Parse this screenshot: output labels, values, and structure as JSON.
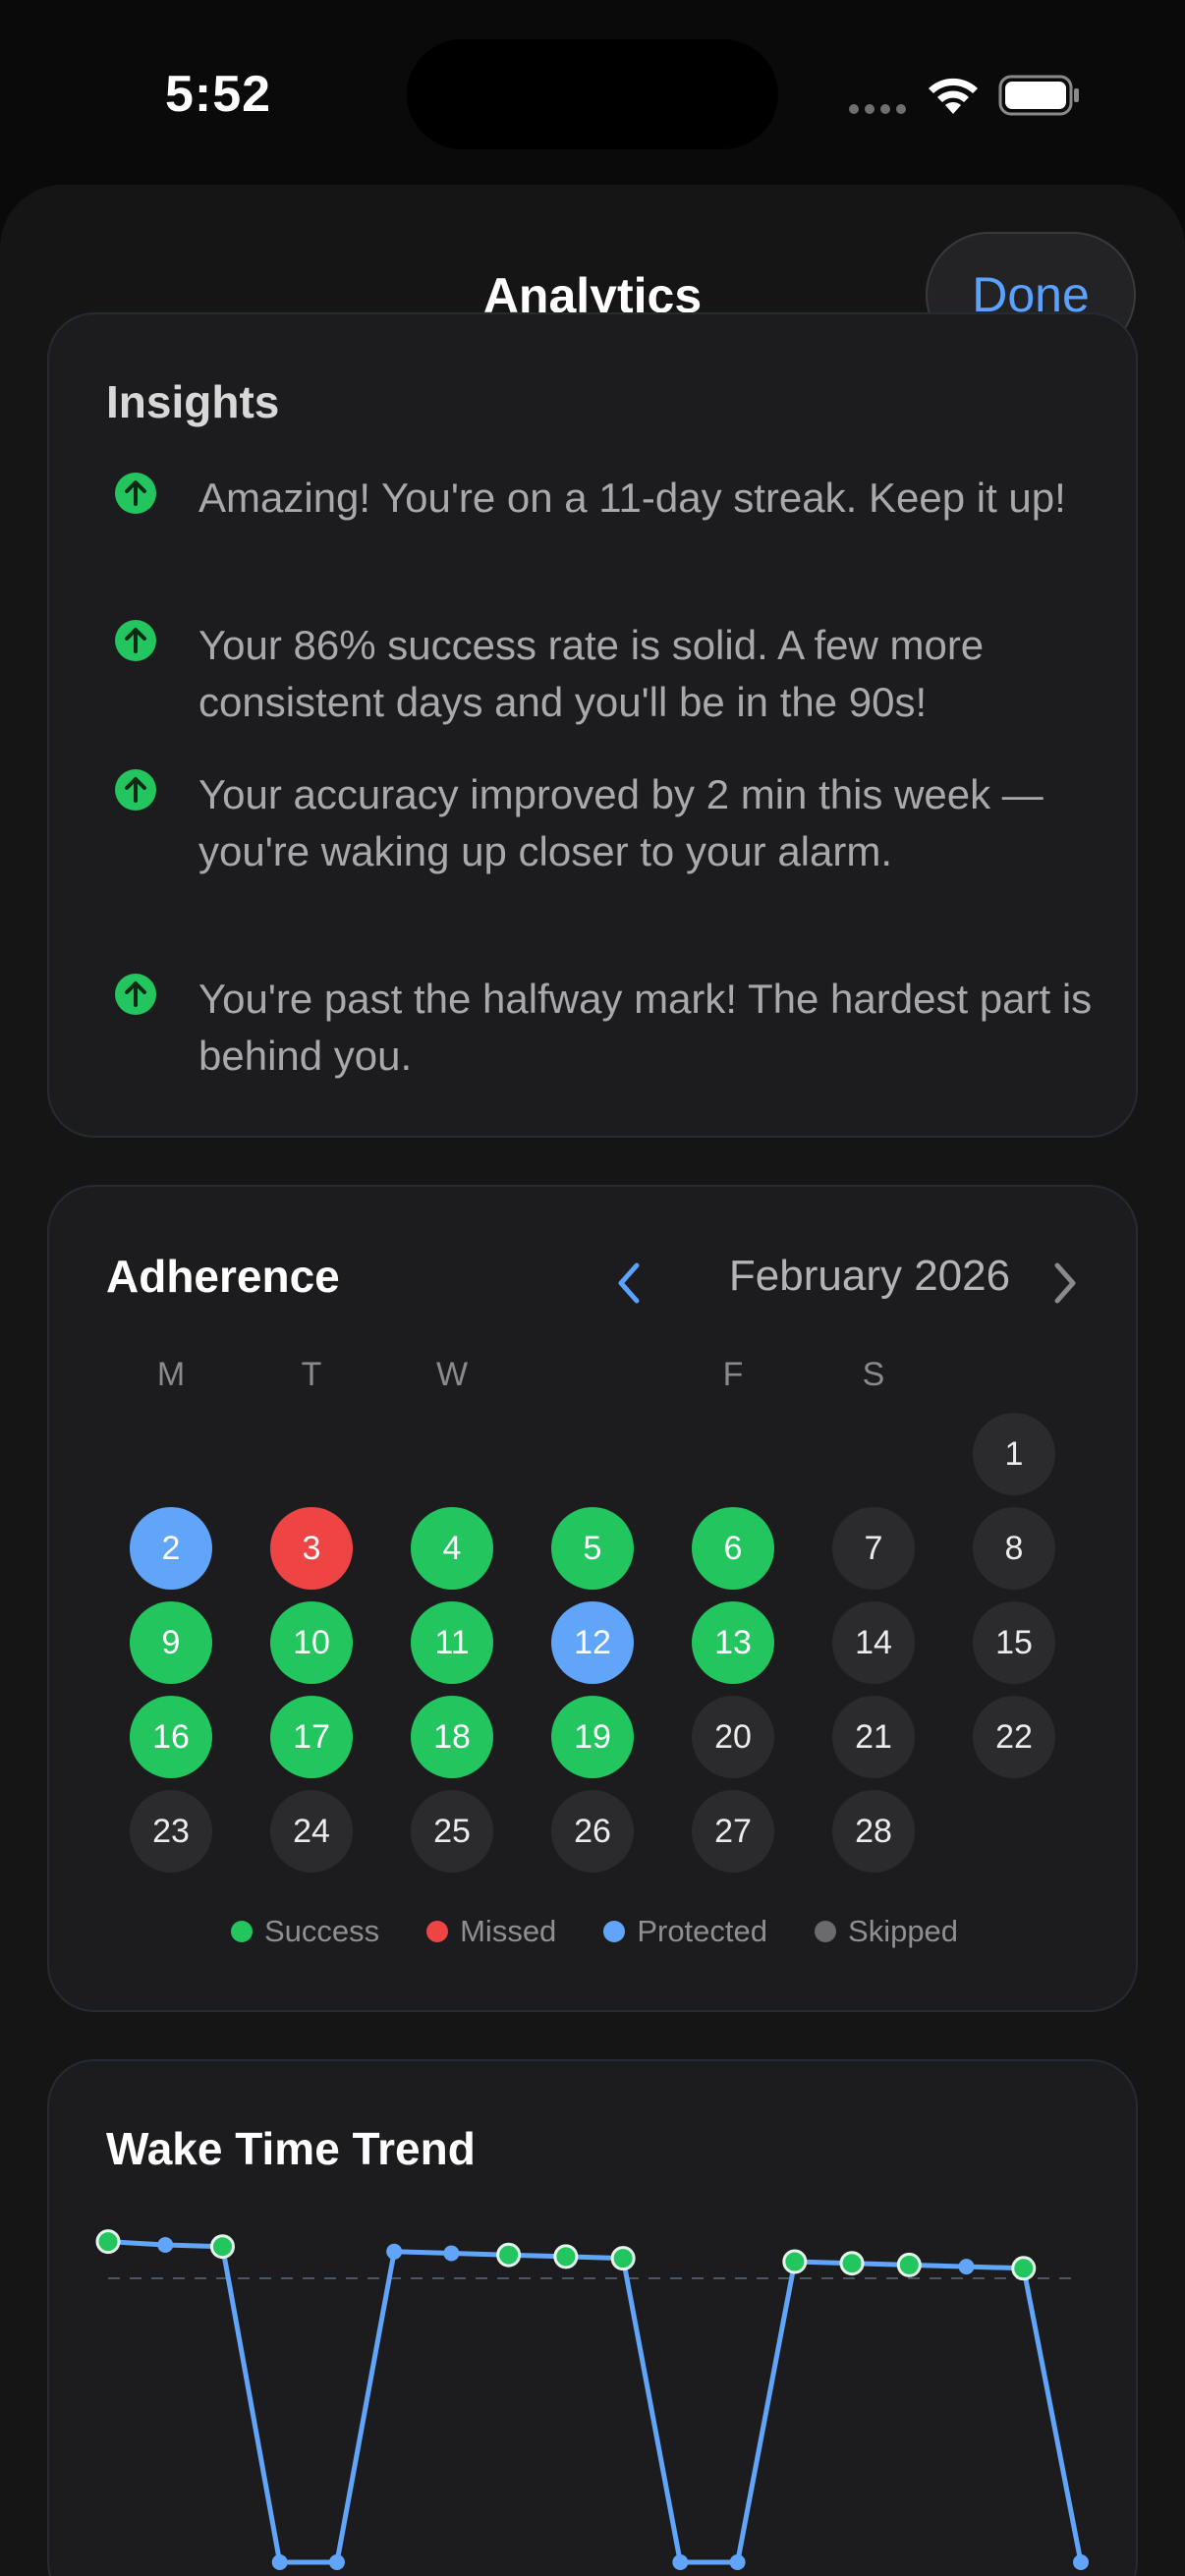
{
  "status": {
    "time": "5:52"
  },
  "header": {
    "title": "Analytics",
    "done_label": "Done"
  },
  "colors": {
    "success": "#22c55e",
    "missed": "#ef4444",
    "protected": "#60a5fa",
    "skipped": "#6b6b6e",
    "accent": "#5aa2ff"
  },
  "insights": {
    "title": "Insights",
    "items": [
      {
        "icon": "arrow-up-circle-icon",
        "text": "Amazing! You're on a 11-day streak. Keep it up!"
      },
      {
        "icon": "arrow-up-circle-icon",
        "text": "Your 86% success rate is solid. A few more consistent days and you'll be in the 90s!"
      },
      {
        "icon": "arrow-up-circle-icon",
        "text": "Your accuracy improved by 2 min this week — you're waking up closer to your alarm."
      },
      {
        "icon": "arrow-up-circle-icon",
        "text": "You're past the halfway mark! The hardest part is behind you."
      }
    ]
  },
  "adherence": {
    "title": "Adherence",
    "month": "February 2026",
    "weekdays": [
      "M",
      "T",
      "W",
      "",
      "F",
      "S",
      ""
    ],
    "days": [
      {
        "d": "1",
        "status": "none"
      },
      {
        "d": "2",
        "status": "protected"
      },
      {
        "d": "3",
        "status": "missed"
      },
      {
        "d": "4",
        "status": "success"
      },
      {
        "d": "5",
        "status": "success"
      },
      {
        "d": "6",
        "status": "success"
      },
      {
        "d": "7",
        "status": "none"
      },
      {
        "d": "8",
        "status": "none"
      },
      {
        "d": "9",
        "status": "success"
      },
      {
        "d": "10",
        "status": "success"
      },
      {
        "d": "11",
        "status": "success"
      },
      {
        "d": "12",
        "status": "protected"
      },
      {
        "d": "13",
        "status": "success"
      },
      {
        "d": "14",
        "status": "none"
      },
      {
        "d": "15",
        "status": "none"
      },
      {
        "d": "16",
        "status": "success"
      },
      {
        "d": "17",
        "status": "success"
      },
      {
        "d": "18",
        "status": "success"
      },
      {
        "d": "19",
        "status": "success"
      },
      {
        "d": "20",
        "status": "none"
      },
      {
        "d": "21",
        "status": "none"
      },
      {
        "d": "22",
        "status": "none"
      },
      {
        "d": "23",
        "status": "none"
      },
      {
        "d": "24",
        "status": "none"
      },
      {
        "d": "25",
        "status": "none"
      },
      {
        "d": "26",
        "status": "none"
      },
      {
        "d": "27",
        "status": "none"
      },
      {
        "d": "28",
        "status": "none"
      }
    ],
    "legend": [
      {
        "label": "Success",
        "color": "#22c55e"
      },
      {
        "label": "Missed",
        "color": "#ef4444"
      },
      {
        "label": "Protected",
        "color": "#60a5fa"
      },
      {
        "label": "Skipped",
        "color": "#6b6b6e"
      }
    ]
  },
  "trend": {
    "title": "Wake Time Trend",
    "chart_data": {
      "type": "line",
      "x": [
        1,
        2,
        3,
        4,
        5,
        6,
        7,
        8,
        9,
        10,
        11,
        12,
        13,
        14,
        15,
        16,
        17,
        18
      ],
      "values": [
        96,
        95,
        94.5,
        0,
        0,
        93,
        92.5,
        92,
        91.5,
        91,
        0,
        0,
        90,
        89.5,
        89,
        88.5,
        88,
        0
      ],
      "success_flags": [
        true,
        false,
        true,
        false,
        false,
        false,
        false,
        true,
        true,
        true,
        false,
        false,
        true,
        true,
        true,
        false,
        true,
        false
      ],
      "reference_value": 85,
      "ylim": [
        0,
        100
      ],
      "line_color": "#60a5fa",
      "marker_success_color": "#22c55e"
    }
  }
}
